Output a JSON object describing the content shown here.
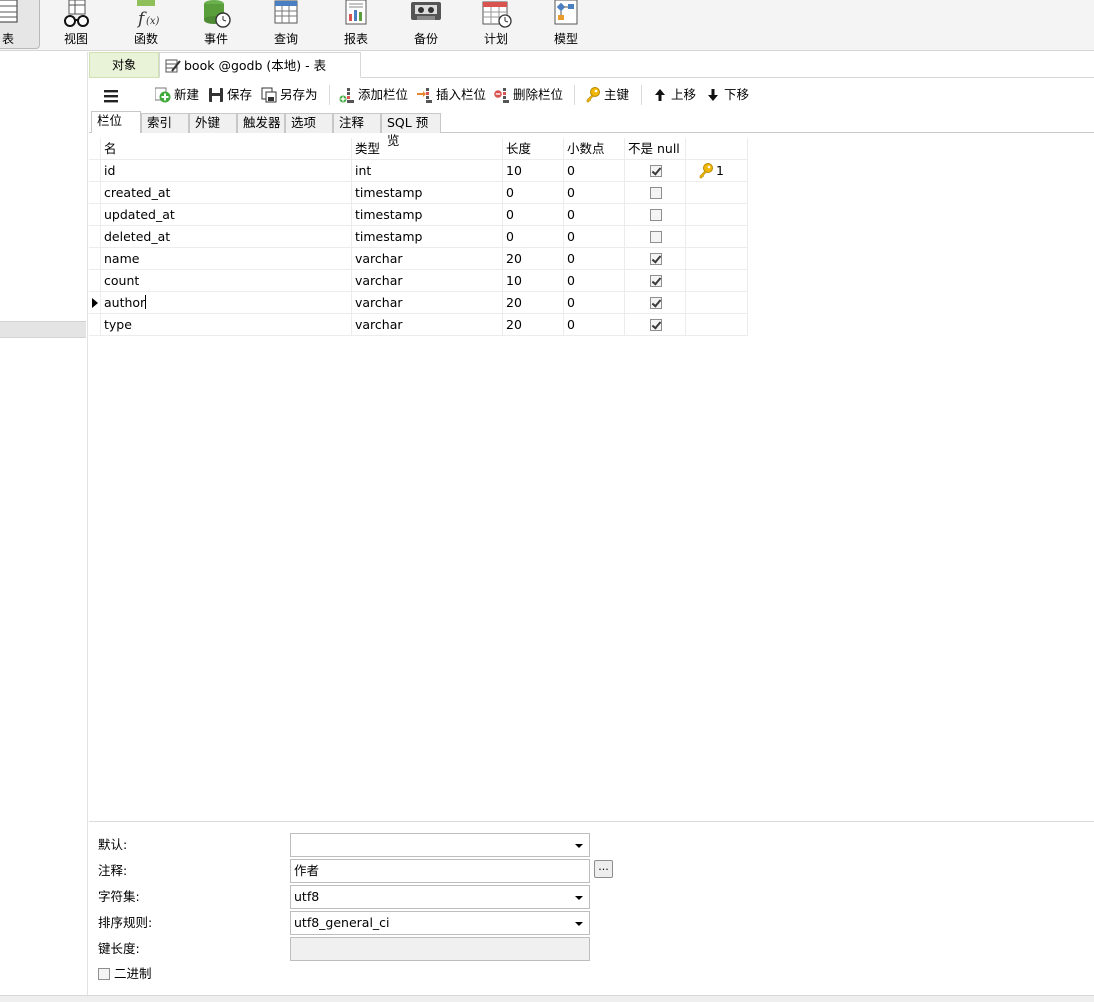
{
  "ribbon": {
    "items": [
      {
        "label": "表",
        "icon": "table-icon"
      },
      {
        "label": "视图",
        "icon": "view-glasses-icon"
      },
      {
        "label": "函数",
        "icon": "function-icon"
      },
      {
        "label": "事件",
        "icon": "event-icon"
      },
      {
        "label": "查询",
        "icon": "query-icon"
      },
      {
        "label": "报表",
        "icon": "report-icon"
      },
      {
        "label": "备份",
        "icon": "backup-icon"
      },
      {
        "label": "计划",
        "icon": "schedule-icon"
      },
      {
        "label": "模型",
        "icon": "model-icon"
      }
    ]
  },
  "tabs": {
    "objects_label": "对象",
    "editor_label": "book @godb (本地) - 表"
  },
  "toolbar": {
    "menu_icon": "hamburger-icon",
    "new_label": "新建",
    "save_label": "保存",
    "save_as_label": "另存为",
    "add_field_label": "添加栏位",
    "insert_field_label": "插入栏位",
    "delete_field_label": "删除栏位",
    "primary_key_label": "主键",
    "move_up_label": "上移",
    "move_down_label": "下移"
  },
  "sub_tabs": [
    "栏位",
    "索引",
    "外键",
    "触发器",
    "选项",
    "注释",
    "SQL 预览"
  ],
  "grid": {
    "headers": {
      "name": "名",
      "type": "类型",
      "length": "长度",
      "decimals": "小数点",
      "not_null": "不是 null",
      "key": ""
    },
    "rows": [
      {
        "name": "id",
        "type": "int",
        "length": "10",
        "decimals": "0",
        "not_null": true,
        "key": "1"
      },
      {
        "name": "created_at",
        "type": "timestamp",
        "length": "0",
        "decimals": "0",
        "not_null": false,
        "key": ""
      },
      {
        "name": "updated_at",
        "type": "timestamp",
        "length": "0",
        "decimals": "0",
        "not_null": false,
        "key": ""
      },
      {
        "name": "deleted_at",
        "type": "timestamp",
        "length": "0",
        "decimals": "0",
        "not_null": false,
        "key": ""
      },
      {
        "name": "name",
        "type": "varchar",
        "length": "20",
        "decimals": "0",
        "not_null": true,
        "key": ""
      },
      {
        "name": "count",
        "type": "varchar",
        "length": "10",
        "decimals": "0",
        "not_null": true,
        "key": ""
      },
      {
        "name": "author",
        "type": "varchar",
        "length": "20",
        "decimals": "0",
        "not_null": true,
        "key": ""
      },
      {
        "name": "type",
        "type": "varchar",
        "length": "20",
        "decimals": "0",
        "not_null": true,
        "key": ""
      }
    ],
    "selected_row": 6
  },
  "props": {
    "default_label": "默认:",
    "default_value": "",
    "comment_label": "注释:",
    "comment_value": "作者",
    "comment_button": "...",
    "charset_label": "字符集:",
    "charset_value": "utf8",
    "collation_label": "排序规则:",
    "collation_value": "utf8_general_ci",
    "key_length_label": "键长度:",
    "key_length_value": "",
    "binary_label": "二进制",
    "binary_checked": false
  }
}
